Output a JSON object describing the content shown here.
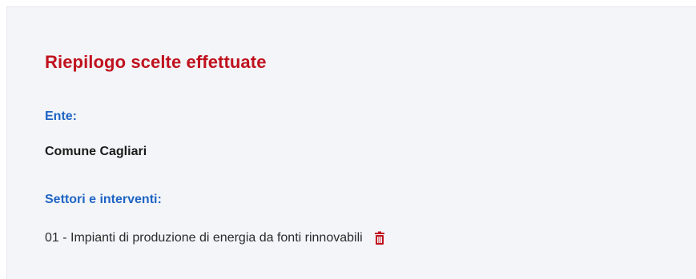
{
  "summary": {
    "title": "Riepilogo scelte effettuate",
    "ente": {
      "label": "Ente:",
      "value": "Comune Cagliari"
    },
    "settori": {
      "label": "Settori e interventi:",
      "items": [
        {
          "text": "01 - Impianti di produzione di energia da fonti rinnovabili",
          "action_icon": "trash-icon"
        }
      ]
    }
  },
  "colors": {
    "title": "#c0121e",
    "label": "#1f64c4",
    "panel_bg": "#f3f5f8",
    "trash": "#c0121e"
  }
}
